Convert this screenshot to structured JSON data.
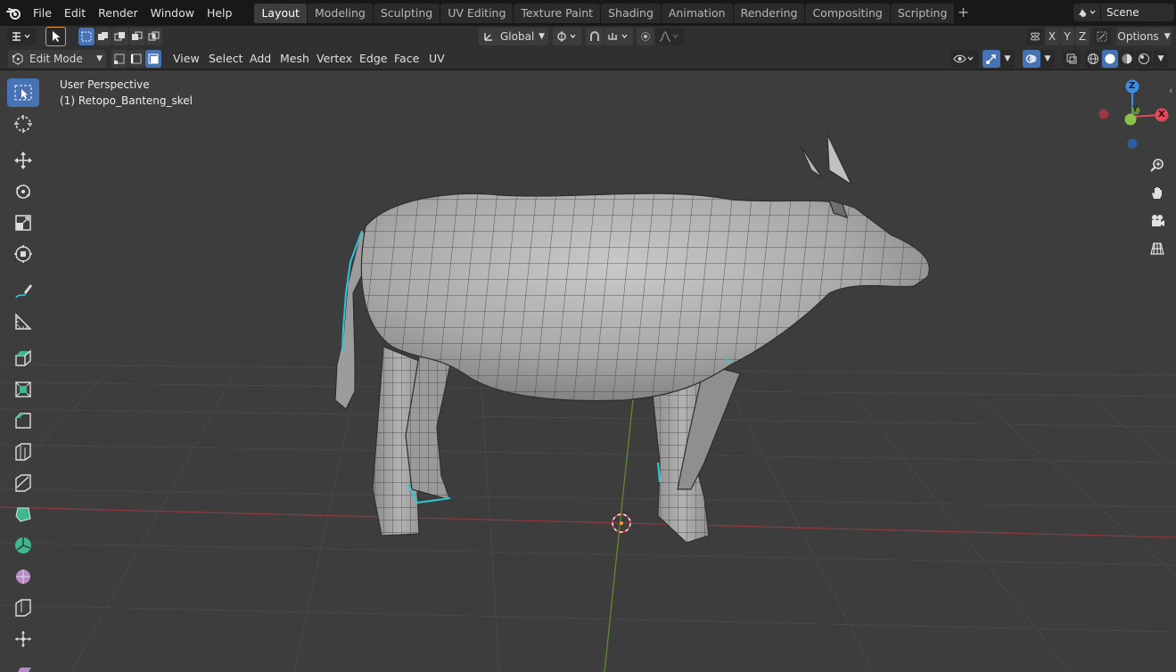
{
  "topbar": {
    "menus": [
      "File",
      "Edit",
      "Render",
      "Window",
      "Help"
    ],
    "workspaces": [
      "Layout",
      "Modeling",
      "Sculpting",
      "UV Editing",
      "Texture Paint",
      "Shading",
      "Animation",
      "Rendering",
      "Compositing",
      "Scripting"
    ],
    "active_workspace": "Layout",
    "scene_name": "Scene"
  },
  "header": {
    "transform_orientation": "Global",
    "options_label": "Options",
    "axis_labels": [
      "X",
      "Y",
      "Z"
    ]
  },
  "viewport_header": {
    "mode": "Edit Mode",
    "menus": [
      "View",
      "Select",
      "Add",
      "Mesh",
      "Vertex",
      "Edge",
      "Face",
      "UV"
    ]
  },
  "viewport": {
    "view_name": "User Perspective",
    "object_name": "(1) Retopo_Banteng_skel"
  },
  "gizmo": {
    "axes": [
      "Z",
      "Y",
      "X"
    ]
  },
  "colors": {
    "accent": "#4772b3",
    "x_axis": "#e24a5a",
    "y_axis": "#8bc34a",
    "z_axis": "#3a8ee6",
    "selection": "#2ec7d6"
  },
  "toolbar": {
    "tools": [
      "select-box",
      "cursor",
      "move",
      "rotate",
      "scale",
      "transform",
      "annotate",
      "measure",
      "extrude-region",
      "inset-faces",
      "bevel",
      "loop-cut",
      "knife",
      "poly-build",
      "spin",
      "smooth",
      "edge-slide",
      "shrink-fatten",
      "shear"
    ]
  }
}
